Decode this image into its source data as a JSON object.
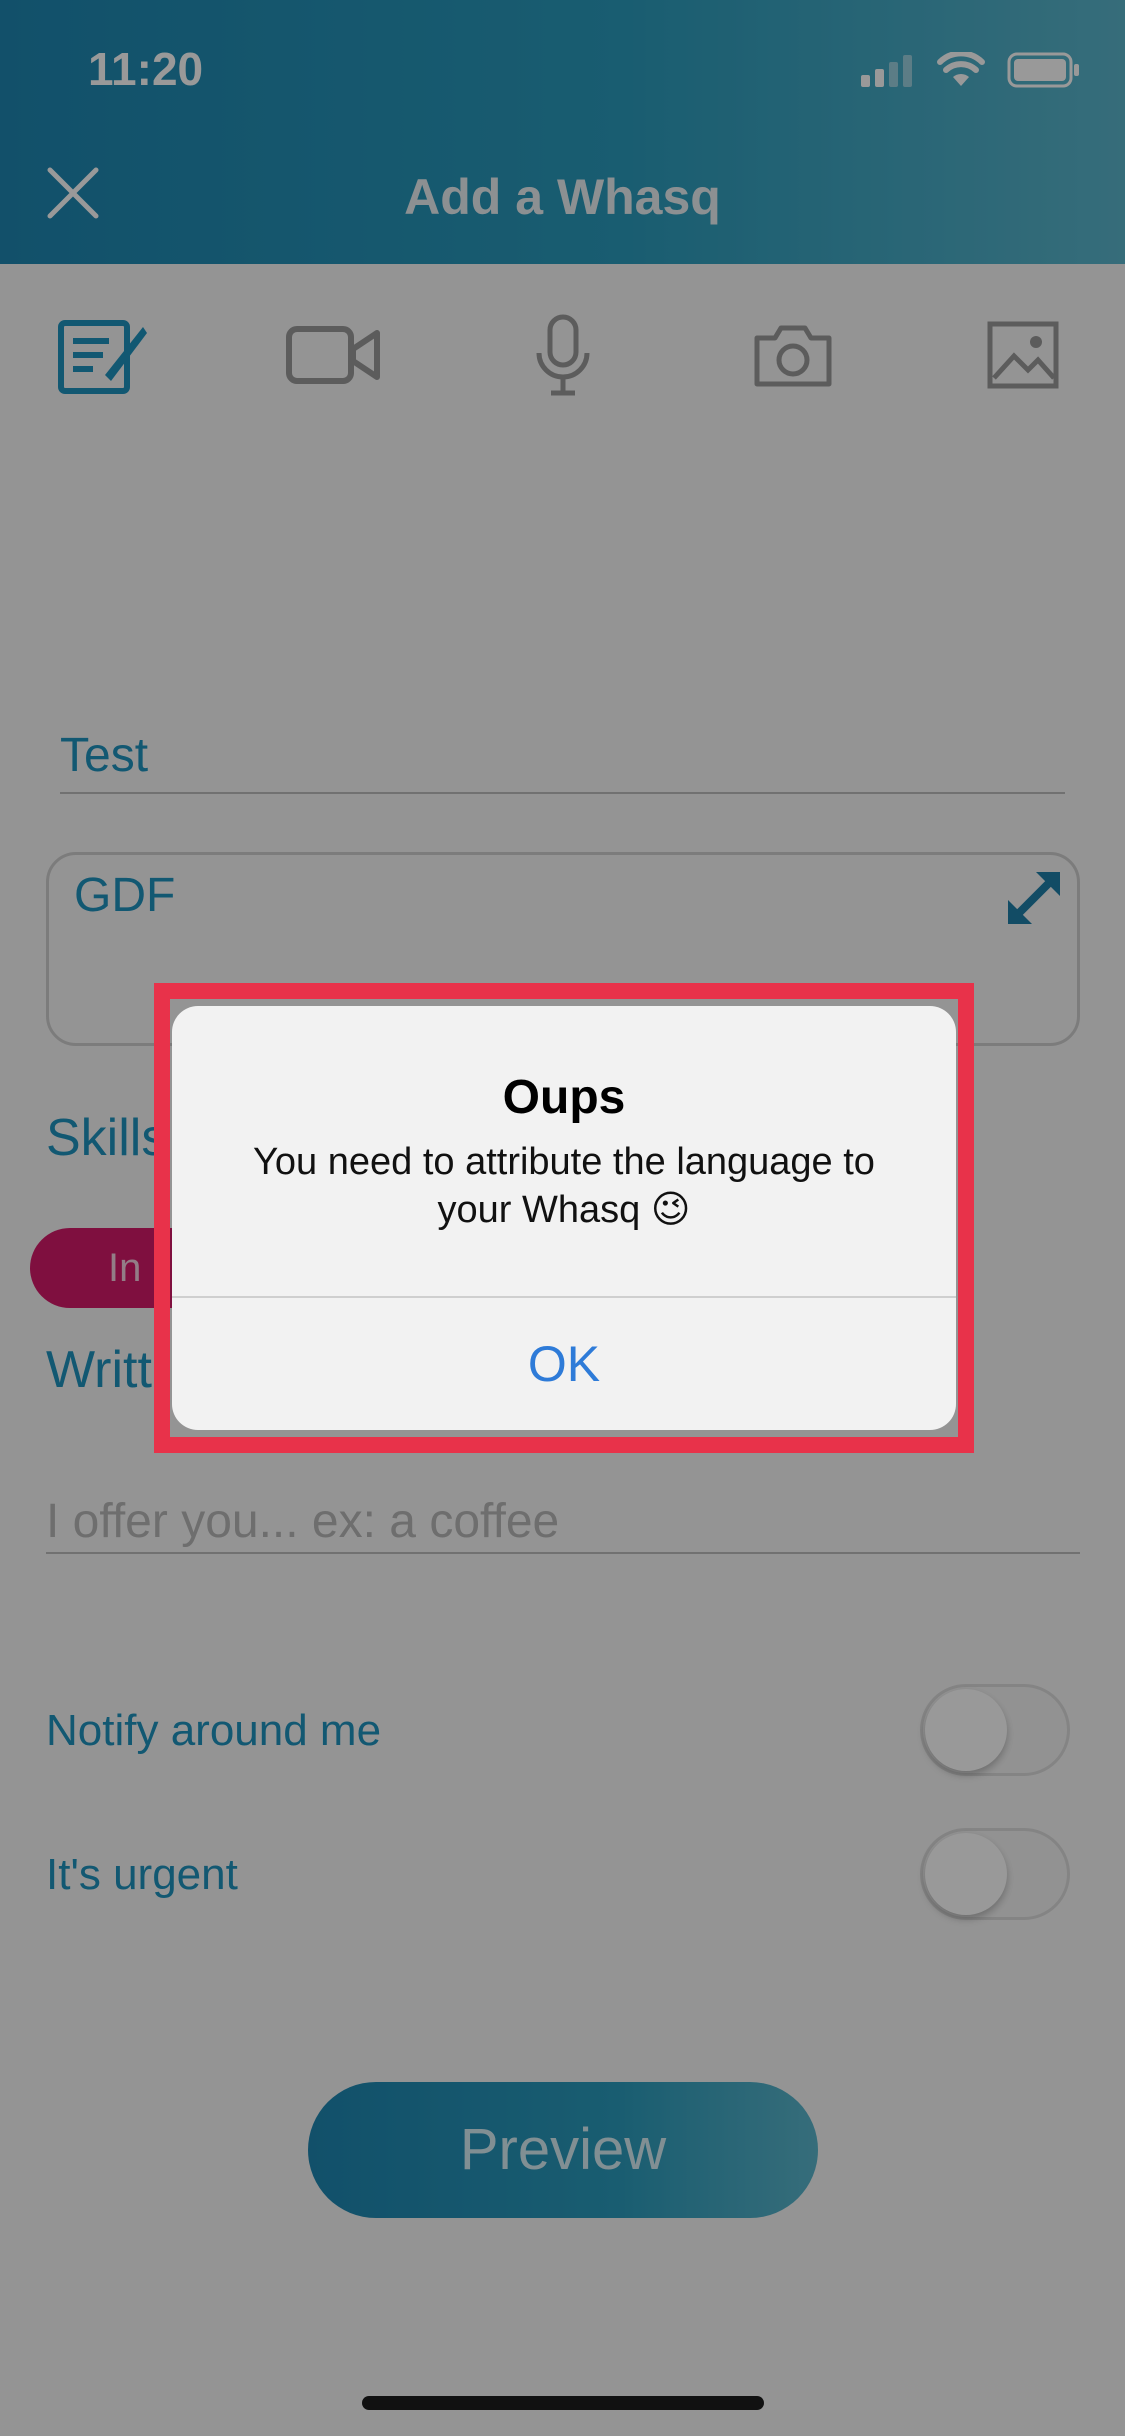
{
  "status_bar": {
    "time": "11:20"
  },
  "header": {
    "title": "Add a Whasq"
  },
  "toolbar": {
    "icons": [
      "text-icon",
      "video-icon",
      "microphone-icon",
      "camera-icon",
      "image-icon"
    ]
  },
  "form": {
    "title_value": "Test",
    "description_value": "GDF",
    "skills_label": "Skills",
    "skill_chip": "In",
    "written_label": "Writt",
    "offer_placeholder": "I offer you... ex: a coffee",
    "notify_label": "Notify around me",
    "urgent_label": "It's urgent",
    "notify_on": false,
    "urgent_on": false
  },
  "preview_button": "Preview",
  "alert": {
    "title": "Oups",
    "message": "You need to attribute the language to your Whasq 😉",
    "ok": "OK"
  },
  "colors": {
    "accent": "#1f93bf",
    "highlight": "#e8324a",
    "chip": "#d4196a",
    "alert_button": "#2e7bd8"
  }
}
